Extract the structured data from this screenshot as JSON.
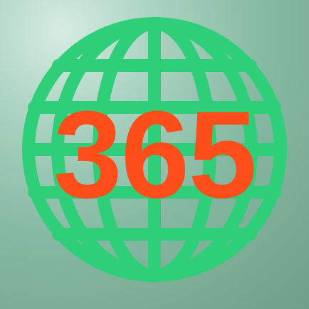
{
  "app_icon": {
    "number_text": "365",
    "icon": "globe-icon",
    "colors": {
      "globe_stroke": "#2fcf7a",
      "number_fill": "#ff4e1a",
      "background_light": "#d6ece2",
      "background_dark": "#6f9f89"
    }
  }
}
